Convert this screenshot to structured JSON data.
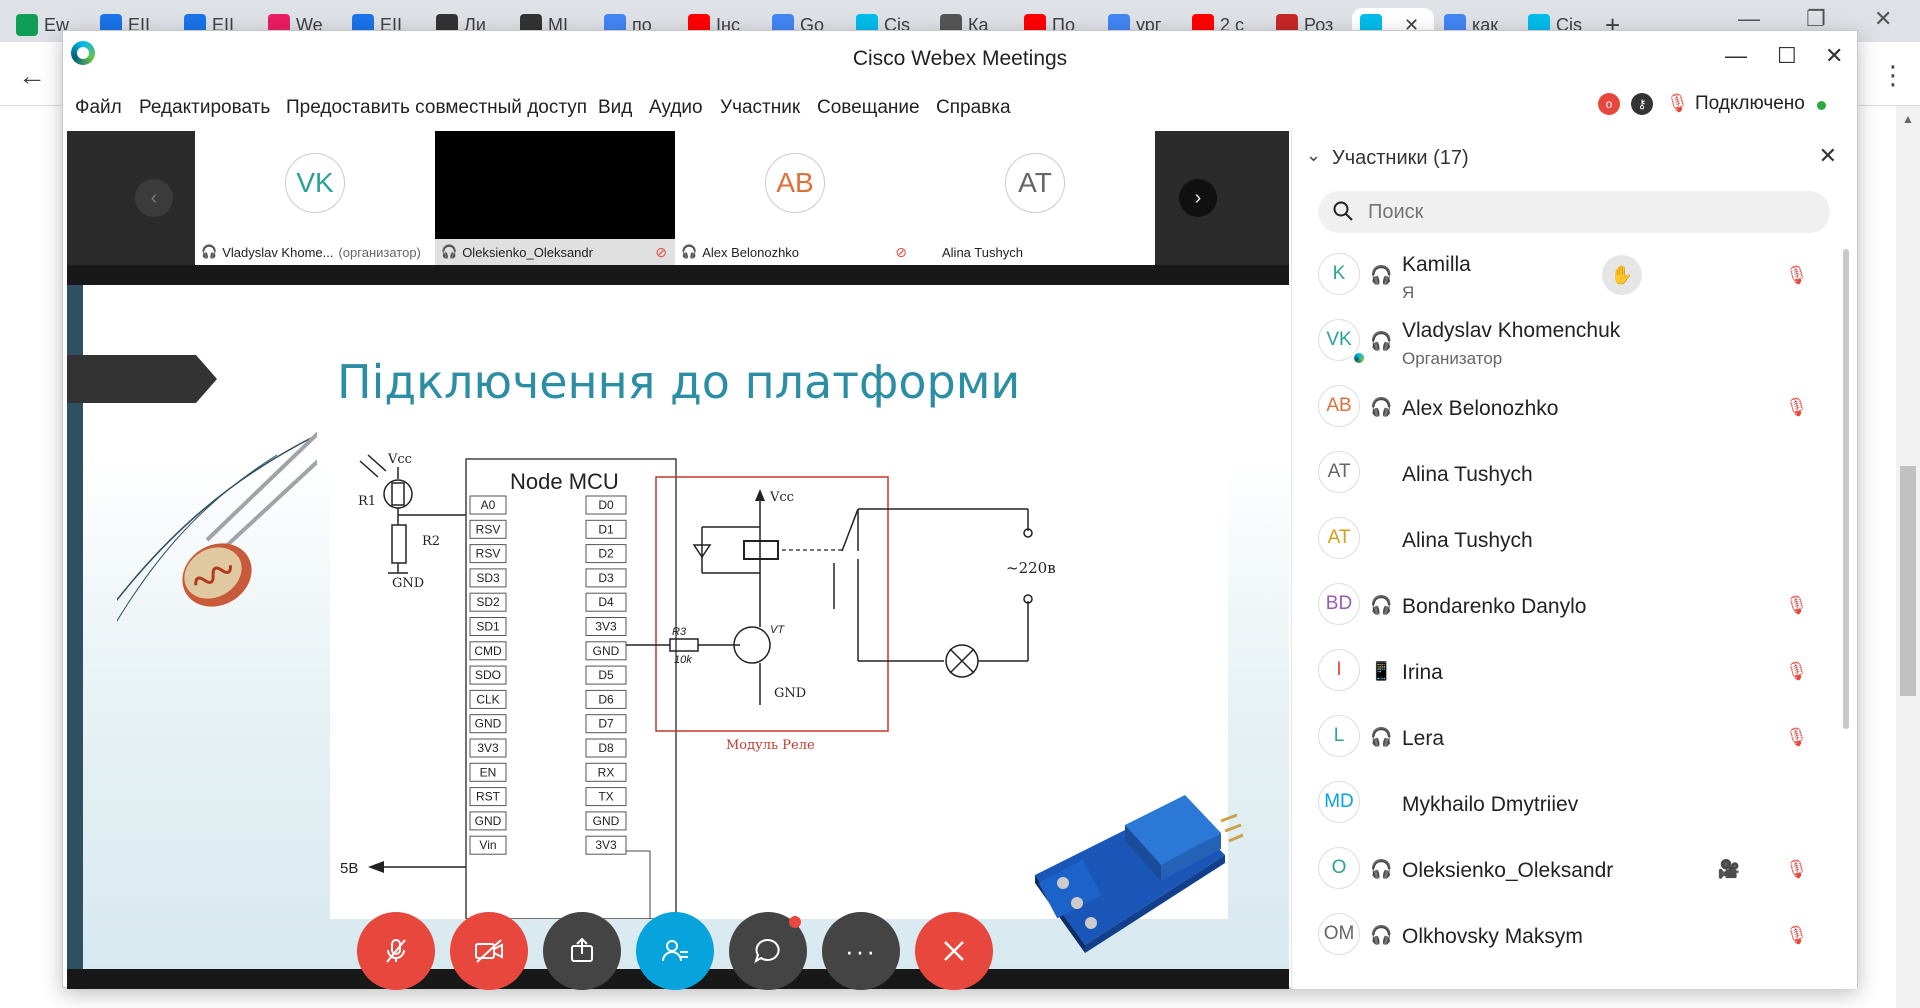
{
  "browser": {
    "tabs": [
      {
        "title": "Ew",
        "icon": "sheets-icon",
        "color": "#0f9d58"
      },
      {
        "title": "EII",
        "icon": "doc-icon",
        "color": "#1a73e8"
      },
      {
        "title": "EII",
        "icon": "doc-icon",
        "color": "#1a73e8"
      },
      {
        "title": "We",
        "icon": "circle-icon",
        "color": "#e91e63"
      },
      {
        "title": "EII",
        "icon": "doc-icon",
        "color": "#1a73e8"
      },
      {
        "title": "Ли",
        "icon": "cap-icon",
        "color": "#333333"
      },
      {
        "title": "MI",
        "icon": "cap-icon",
        "color": "#333333"
      },
      {
        "title": "по",
        "icon": "google-icon",
        "color": "#4285f4"
      },
      {
        "title": "Інс",
        "icon": "youtube-icon",
        "color": "#ff0000"
      },
      {
        "title": "Go",
        "icon": "translate-icon",
        "color": "#4285f4"
      },
      {
        "title": "Cis",
        "icon": "webex-icon",
        "color": "#00bceb"
      },
      {
        "title": "Ка",
        "icon": "app-icon",
        "color": "#555555"
      },
      {
        "title": "По",
        "icon": "youtube-icon",
        "color": "#ff0000"
      },
      {
        "title": "ург",
        "icon": "google-icon",
        "color": "#4285f4"
      },
      {
        "title": "2 с",
        "icon": "youtube-icon",
        "color": "#ff0000"
      },
      {
        "title": "Роз",
        "icon": "brand-icon",
        "color": "#c62828"
      },
      {
        "title": "",
        "icon": "webex-icon",
        "color": "#00bceb",
        "active": true
      },
      {
        "title": "как",
        "icon": "google-icon",
        "color": "#4285f4"
      },
      {
        "title": "Cis",
        "icon": "webex-icon",
        "color": "#00bceb"
      }
    ]
  },
  "window": {
    "title": "Cisco Webex Meetings"
  },
  "menu": {
    "items": [
      "Файл",
      "Редактировать",
      "Предоставить совместный доступ",
      "Вид",
      "Аудио",
      "Участник",
      "Совещание",
      "Справка"
    ],
    "status": "Подключено",
    "record_badge": "o"
  },
  "filmstrip": {
    "tiles": [
      {
        "initials": "VK",
        "name": "Vladyslav Khome...",
        "role": "(организатор)",
        "color": "#2aa198",
        "muted": false,
        "video": false
      },
      {
        "initials": "",
        "name": "Oleksienko_Oleksandr",
        "role": "",
        "color": "#000000",
        "muted": true,
        "video": true
      },
      {
        "initials": "AB",
        "name": "Alex Belonozhko",
        "role": "",
        "color": "#e0703a",
        "muted": true,
        "video": false
      },
      {
        "initials": "AT",
        "name": "Alina Tushych",
        "role": "",
        "color": "#666666",
        "muted": false,
        "video": false
      }
    ]
  },
  "slide": {
    "title": "Підключення до платформи",
    "diagram": {
      "mcu_title": "Node MCU",
      "left_pins": [
        "A0",
        "RSV",
        "RSV",
        "SD3",
        "SD2",
        "SD1",
        "CMD",
        "SDO",
        "CLK",
        "GND",
        "3V3",
        "EN",
        "RST",
        "GND",
        "Vin"
      ],
      "right_pins": [
        "D0",
        "D1",
        "D2",
        "D3",
        "D4",
        "3V3",
        "GND",
        "D5",
        "D6",
        "D7",
        "D8",
        "RX",
        "TX",
        "GND",
        "3V3"
      ],
      "vcc": "Vcc",
      "r1": "R1",
      "r2": "R2",
      "gnd": "GND",
      "relay_vcc": "Vcc",
      "r3": "R3",
      "r3_val": "10k",
      "vt": "VT",
      "relay_gnd": "GND",
      "relay_label": "Модуль Реле",
      "mains": "~220в",
      "vin_label": "5В"
    }
  },
  "participants": {
    "title": "Участники (17)",
    "search_placeholder": "Поиск",
    "list": [
      {
        "initials": "K",
        "name": "Kamilla",
        "sub": "Я",
        "color": "#2aa198",
        "headset": true,
        "muted": true,
        "raise": true
      },
      {
        "initials": "VK",
        "name": "Vladyslav Khomenchuk",
        "sub": "Организатор",
        "color": "#2aa198",
        "headset": true,
        "muted": false,
        "host": true
      },
      {
        "initials": "AB",
        "name": "Alex Belonozhko",
        "sub": "",
        "color": "#e0703a",
        "headset": true,
        "muted": true
      },
      {
        "initials": "AT",
        "name": "Alina Tushych",
        "sub": "",
        "color": "#666666",
        "headset": false,
        "muted": false
      },
      {
        "initials": "AT",
        "name": "Alina Tushych",
        "sub": "",
        "color": "#d4a017",
        "headset": false,
        "muted": false
      },
      {
        "initials": "BD",
        "name": "Bondarenko Danylo",
        "sub": "",
        "color": "#9b59b6",
        "headset": true,
        "muted": true
      },
      {
        "initials": "I",
        "name": "Irina",
        "sub": "",
        "color": "#e8473e",
        "phone": true,
        "muted": true
      },
      {
        "initials": "L",
        "name": "Lera",
        "sub": "",
        "color": "#2aa198",
        "headset": true,
        "muted": true
      },
      {
        "initials": "MD",
        "name": "Mykhailo Dmytriiev",
        "sub": "",
        "color": "#07a3dc",
        "headset": false,
        "muted": false
      },
      {
        "initials": "O",
        "name": "Oleksienko_Oleksandr",
        "sub": "",
        "color": "#2aa198",
        "headset": true,
        "muted": true,
        "camera": true
      },
      {
        "initials": "OM",
        "name": "Olkhovsky Maksym",
        "sub": "",
        "color": "#666666",
        "headset": true,
        "muted": true
      }
    ]
  },
  "colors": {
    "accent": "#07a3dc",
    "danger": "#e8473e",
    "connected": "#2bab3f",
    "title_teal": "#2c8ea4"
  }
}
